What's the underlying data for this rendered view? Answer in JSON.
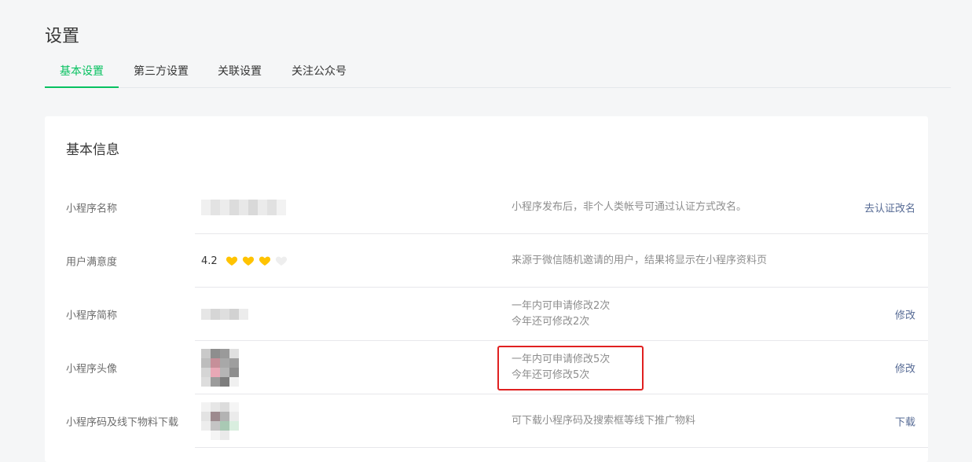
{
  "page": {
    "title": "设置"
  },
  "tabs": [
    {
      "label": "基本设置",
      "active": true
    },
    {
      "label": "第三方设置",
      "active": false
    },
    {
      "label": "关联设置",
      "active": false
    },
    {
      "label": "关注公众号",
      "active": false
    }
  ],
  "basic_info": {
    "title": "基本信息",
    "rows": [
      {
        "label": "小程序名称",
        "desc": "小程序发布后，非个人类帐号可通过认证方式改名。",
        "action": "去认证改名"
      },
      {
        "label": "用户满意度",
        "score": "4.2",
        "rating": 3,
        "rating_max": 4,
        "desc": "来源于微信随机邀请的用户，结果将显示在小程序资料页"
      },
      {
        "label": "小程序简称",
        "desc_line1": "一年内可申请修改2次",
        "desc_line2": "今年还可修改2次",
        "action": "修改"
      },
      {
        "label": "小程序头像",
        "desc_line1": "一年内可申请修改5次",
        "desc_line2": "今年还可修改5次",
        "action": "修改"
      },
      {
        "label": "小程序码及线下物料下载",
        "desc": "可下载小程序码及搜索框等线下推广物料",
        "action": "下载"
      }
    ]
  },
  "colors": {
    "accent": "#07c160",
    "link": "#576b95",
    "heart_filled": "#ffc300",
    "heart_empty": "#eeeeee",
    "highlight_border": "#e02020"
  }
}
